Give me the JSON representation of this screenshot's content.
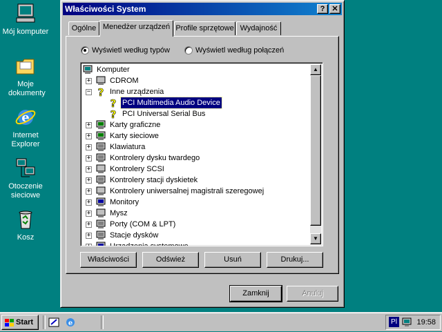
{
  "desktop": {
    "icons": [
      {
        "label": "Mój komputer"
      },
      {
        "label": "Moje dokumenty"
      },
      {
        "label": "Internet Explorer"
      },
      {
        "label": "Otoczenie sieciowe"
      },
      {
        "label": "Kosz"
      }
    ]
  },
  "window": {
    "title": "Właściwości System",
    "help_label": "?",
    "close_label": "✕",
    "tabs": [
      {
        "label": "Ogólne",
        "active": false
      },
      {
        "label": "Menedżer urządzeń",
        "active": true
      },
      {
        "label": "Profile sprzętowe",
        "active": false
      },
      {
        "label": "Wydajność",
        "active": false
      }
    ],
    "view_options": [
      {
        "label": "Wyświetl według typów",
        "selected": true
      },
      {
        "label": "Wyświetl według połączeń",
        "selected": false
      }
    ],
    "tree": [
      {
        "label": "Komputer",
        "level": 0,
        "icon": "computer-icon",
        "expander": ""
      },
      {
        "label": "CDROM",
        "level": 1,
        "icon": "cdrom-icon",
        "expander": "+"
      },
      {
        "label": "Inne urządzenia",
        "level": 1,
        "icon": "question-icon",
        "expander": "−"
      },
      {
        "label": "PCI Multimedia Audio Device",
        "level": 2,
        "icon": "question-icon",
        "expander": "",
        "selected": true
      },
      {
        "label": "PCI Universal Serial Bus",
        "level": 2,
        "icon": "question-icon",
        "expander": ""
      },
      {
        "label": "Karty graficzne",
        "level": 1,
        "icon": "display-adapter-icon",
        "expander": "+"
      },
      {
        "label": "Karty sieciowe",
        "level": 1,
        "icon": "network-card-icon",
        "expander": "+"
      },
      {
        "label": "Klawiatura",
        "level": 1,
        "icon": "keyboard-icon",
        "expander": "+"
      },
      {
        "label": "Kontrolery dysku twardego",
        "level": 1,
        "icon": "hdd-controller-icon",
        "expander": "+"
      },
      {
        "label": "Kontrolery SCSI",
        "level": 1,
        "icon": "scsi-icon",
        "expander": "+"
      },
      {
        "label": "Kontrolery stacji dyskietek",
        "level": 1,
        "icon": "floppy-controller-icon",
        "expander": "+"
      },
      {
        "label": "Kontrolery uniwersalnej magistrali szeregowej",
        "level": 1,
        "icon": "usb-icon",
        "expander": "+"
      },
      {
        "label": "Monitory",
        "level": 1,
        "icon": "monitor-icon",
        "expander": "+"
      },
      {
        "label": "Mysz",
        "level": 1,
        "icon": "mouse-icon",
        "expander": "+"
      },
      {
        "label": "Porty (COM & LPT)",
        "level": 1,
        "icon": "port-icon",
        "expander": "+"
      },
      {
        "label": "Stacje dysków",
        "level": 1,
        "icon": "disk-drive-icon",
        "expander": "+"
      },
      {
        "label": "Urządzenia systemowe",
        "level": 1,
        "icon": "system-device-icon",
        "expander": "+"
      }
    ],
    "buttons": {
      "properties": "Właściwości",
      "refresh": "Odśwież",
      "remove": "Usuń",
      "print": "Drukuj...",
      "close": "Zamknij",
      "cancel": "Anuluj"
    }
  },
  "taskbar": {
    "start_label": "Start",
    "language": "Pl",
    "clock": "19:58"
  }
}
